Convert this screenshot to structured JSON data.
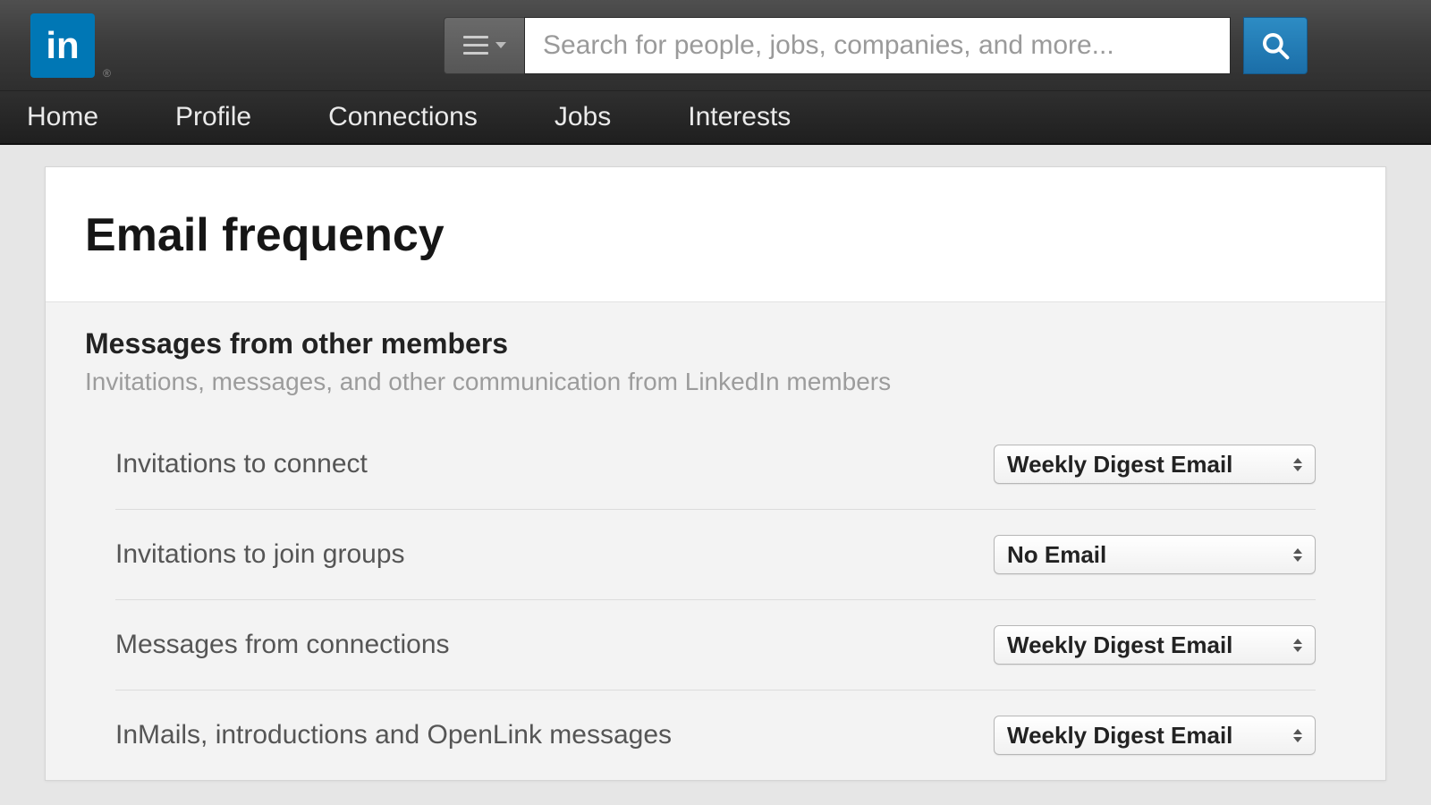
{
  "header": {
    "logo_text": "in",
    "search_placeholder": "Search for people, jobs, companies, and more..."
  },
  "nav": {
    "items": [
      "Home",
      "Profile",
      "Connections",
      "Jobs",
      "Interests"
    ]
  },
  "page": {
    "title": "Email frequency"
  },
  "section": {
    "title": "Messages from other members",
    "subtitle": "Invitations, messages, and other communication from LinkedIn members",
    "rows": [
      {
        "label": "Invitations to connect",
        "value": "Weekly Digest Email"
      },
      {
        "label": "Invitations to join groups",
        "value": "No Email"
      },
      {
        "label": "Messages from connections",
        "value": "Weekly Digest Email"
      },
      {
        "label": "InMails, introductions and OpenLink messages",
        "value": "Weekly Digest Email"
      }
    ]
  }
}
